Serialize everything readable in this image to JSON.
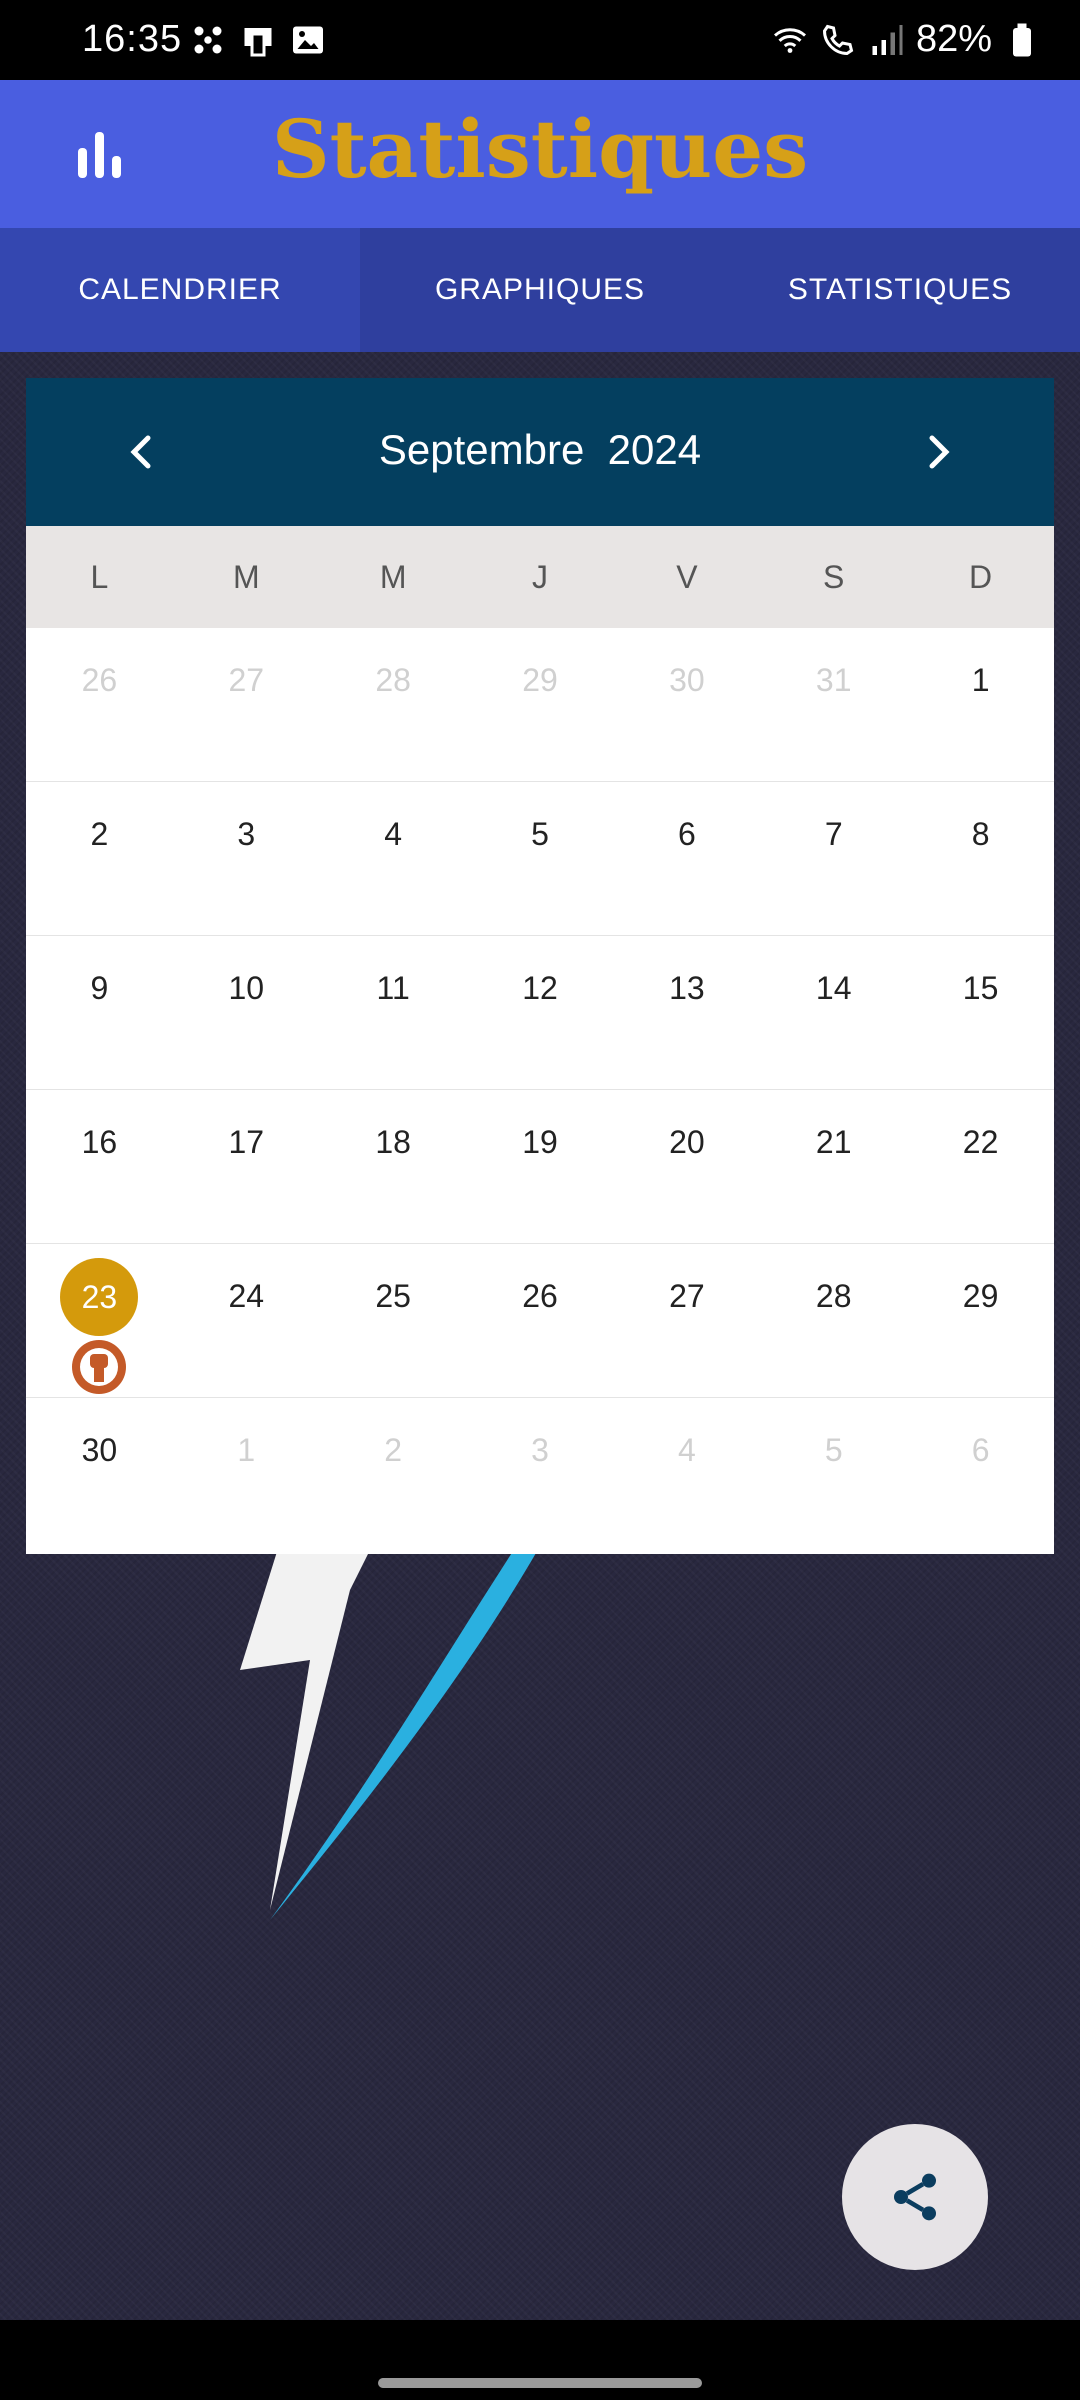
{
  "status_bar": {
    "time": "16:35",
    "battery": "82%"
  },
  "app": {
    "title": "Statistiques"
  },
  "tabs": [
    {
      "label": "CALENDRIER",
      "active": true
    },
    {
      "label": "GRAPHIQUES",
      "active": false
    },
    {
      "label": "STATISTIQUES",
      "active": false
    }
  ],
  "calendar": {
    "month": "Septembre",
    "year": "2024",
    "weekdays": [
      "L",
      "M",
      "M",
      "J",
      "V",
      "S",
      "D"
    ],
    "weeks": [
      [
        {
          "d": "26",
          "o": true
        },
        {
          "d": "27",
          "o": true
        },
        {
          "d": "28",
          "o": true
        },
        {
          "d": "29",
          "o": true
        },
        {
          "d": "30",
          "o": true
        },
        {
          "d": "31",
          "o": true
        },
        {
          "d": "1"
        }
      ],
      [
        {
          "d": "2"
        },
        {
          "d": "3"
        },
        {
          "d": "4"
        },
        {
          "d": "5"
        },
        {
          "d": "6"
        },
        {
          "d": "7"
        },
        {
          "d": "8"
        }
      ],
      [
        {
          "d": "9"
        },
        {
          "d": "10"
        },
        {
          "d": "11"
        },
        {
          "d": "12"
        },
        {
          "d": "13"
        },
        {
          "d": "14"
        },
        {
          "d": "15"
        }
      ],
      [
        {
          "d": "16"
        },
        {
          "d": "17"
        },
        {
          "d": "18"
        },
        {
          "d": "19"
        },
        {
          "d": "20"
        },
        {
          "d": "21"
        },
        {
          "d": "22"
        }
      ],
      [
        {
          "d": "23",
          "today": true,
          "event": true
        },
        {
          "d": "24"
        },
        {
          "d": "25"
        },
        {
          "d": "26"
        },
        {
          "d": "27"
        },
        {
          "d": "28"
        },
        {
          "d": "29"
        }
      ],
      [
        {
          "d": "30"
        },
        {
          "d": "1",
          "o": true
        },
        {
          "d": "2",
          "o": true
        },
        {
          "d": "3",
          "o": true
        },
        {
          "d": "4",
          "o": true
        },
        {
          "d": "5",
          "o": true
        },
        {
          "d": "6",
          "o": true
        }
      ]
    ]
  },
  "colors": {
    "app_bar": "#4a5ee0",
    "title": "#d6a018",
    "tabs": "#2f3f9e",
    "calendar_header": "#043f5f",
    "today": "#d49a0c"
  },
  "icons": {
    "app": "bar-chart-icon",
    "prev": "chevron-left-icon",
    "next": "chevron-right-icon",
    "event": "raised-fist-icon",
    "fab": "share-icon"
  }
}
